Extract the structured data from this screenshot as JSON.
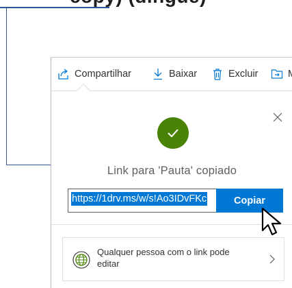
{
  "heading_fragment": "copy) (dingue)",
  "toolbar": {
    "share_label": "Compartilhar",
    "download_label": "Baixar",
    "delete_label": "Excluir",
    "move_label": "M"
  },
  "icons": {
    "share": "share-icon",
    "download": "download-arrow-icon",
    "delete": "trash-icon",
    "move": "move-to-folder-icon",
    "close": "close-x-icon",
    "success": "checkmark-icon",
    "permission": "globe-icon",
    "chevron": "chevron-right-icon",
    "cursor": "mouse-pointer-icon"
  },
  "dialog": {
    "status_text": "Link para 'Pauta' copiado",
    "link_value": "https://1drv.ms/w/s!Ao3IDvFKc",
    "copy_button": "Copiar",
    "permission_text": "Qualquer pessoa com o link pode editar"
  },
  "colors": {
    "success_green": "#498205",
    "accent_blue": "#0078d4",
    "callout_line": "#2f5597"
  }
}
